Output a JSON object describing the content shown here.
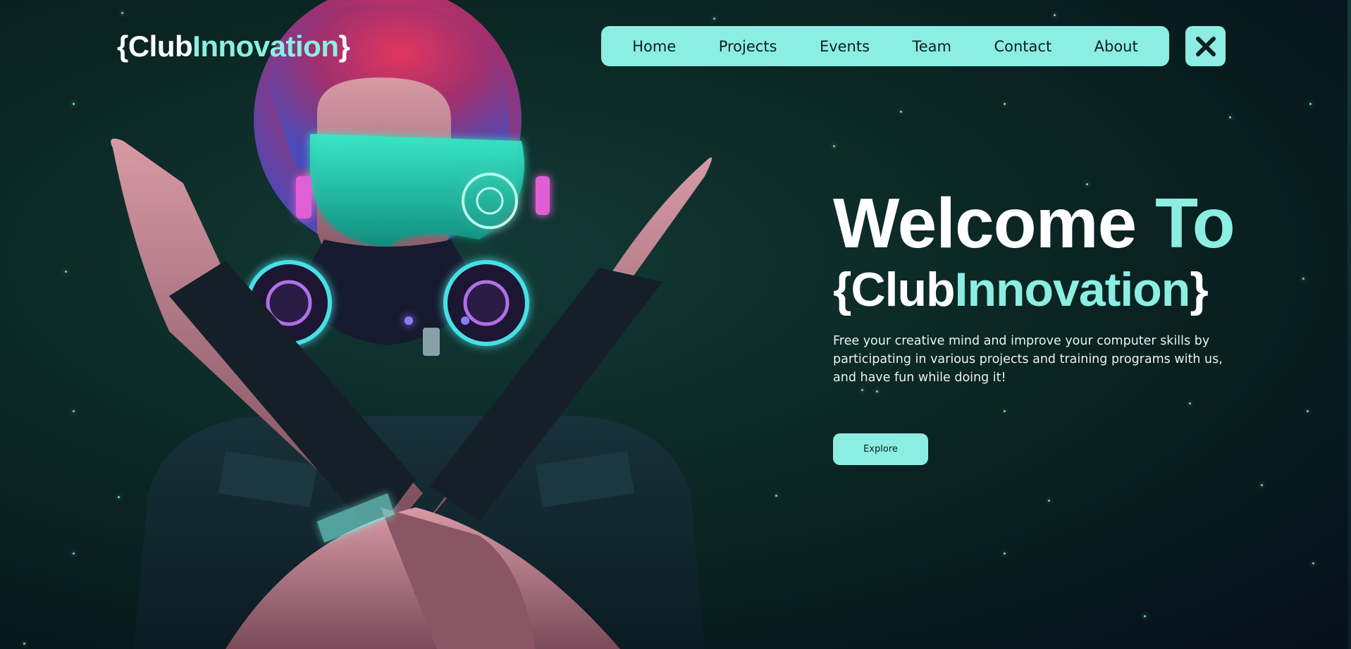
{
  "brand": {
    "logo_prefix": "{Club",
    "logo_accent": "Innovation",
    "logo_suffix": "}"
  },
  "nav": {
    "items": [
      {
        "label": "Home"
      },
      {
        "label": "Projects"
      },
      {
        "label": "Events"
      },
      {
        "label": "Team"
      },
      {
        "label": "Contact"
      },
      {
        "label": "About"
      }
    ],
    "close_icon": "close-icon"
  },
  "hero": {
    "title_main": "Welcome ",
    "title_accent": "To",
    "subtitle_prefix": "{Club",
    "subtitle_accent": "Innovation",
    "subtitle_suffix": "}",
    "description": "Free your creative mind and improve your computer skills by participating in various projects and training programs with us, and have fun while doing it!",
    "cta_label": "Explore"
  },
  "colors": {
    "accent": "#8ceee2",
    "background": "#0b2623",
    "nav_text": "#0b1e21"
  }
}
